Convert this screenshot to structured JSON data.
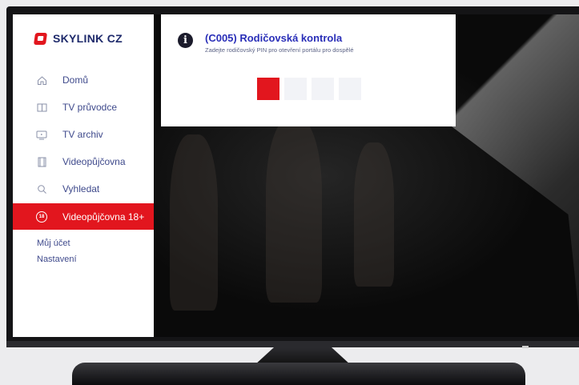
{
  "brand": {
    "name": "SKYLINK CZ",
    "accent": "#e2161e",
    "text_color": "#1e2a6b"
  },
  "sidebar": {
    "items": [
      {
        "icon": "home-icon",
        "label": "Domů",
        "active": false
      },
      {
        "icon": "book-icon",
        "label": "TV průvodce",
        "active": false
      },
      {
        "icon": "tv-icon",
        "label": "TV archiv",
        "active": false
      },
      {
        "icon": "film-icon",
        "label": "Videopůjčovna",
        "active": false
      },
      {
        "icon": "search-icon",
        "label": "Vyhledat",
        "active": false
      },
      {
        "icon": "adult-18-icon",
        "label": "Videopůjčovna 18+",
        "active": true
      }
    ],
    "sub_links": [
      "Můj účet",
      "Nastavení"
    ]
  },
  "dialog": {
    "icon": "info-icon",
    "title": "(C005) Rodičovská kontrola",
    "subtitle": "Zadejte rodičovský PIN pro otevření portálu pro dospělé",
    "pin_digits": 4,
    "pin_active_index": 0
  }
}
